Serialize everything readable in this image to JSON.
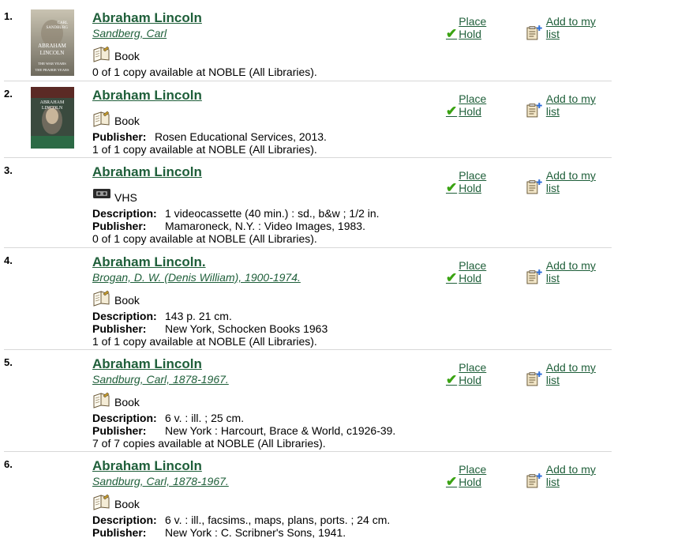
{
  "actions": {
    "place_hold": "Place Hold",
    "add_to_list": "Add to my list"
  },
  "labels": {
    "description": "Description:",
    "publisher": "Publisher:"
  },
  "covers": {
    "c1": {
      "line1": "CARL",
      "line2": "SANDBURG",
      "line3": "ABRAHAM",
      "line4": "LINCOLN",
      "line5": "THE WAR YEARS",
      "line6": "THE PRAIRIE YEARS"
    },
    "c2": {
      "title1": "ABRAHAM",
      "title2": "LINCOLN"
    }
  },
  "results": [
    {
      "num": "1.",
      "title": "Abraham Lincoln",
      "author": "Sandberg, Carl",
      "format": "Book",
      "availability": "0 of 1 copy available at NOBLE (All Libraries)."
    },
    {
      "num": "2.",
      "title": "Abraham Lincoln",
      "format": "Book",
      "publisher": "Rosen Educational Services, 2013.",
      "availability": "1 of 1 copy available at NOBLE (All Libraries)."
    },
    {
      "num": "3.",
      "title": "Abraham Lincoln",
      "format": "VHS",
      "description": "1 videocassette (40 min.) : sd., b&w ; 1/2 in.",
      "publisher": "Mamaroneck, N.Y. : Video Images, 1983.",
      "availability": "0 of 1 copy available at NOBLE (All Libraries)."
    },
    {
      "num": "4.",
      "title": "Abraham Lincoln.",
      "author": "Brogan, D. W. (Denis William), 1900-1974.",
      "format": "Book",
      "description": "143 p. 21 cm.",
      "publisher": "New York, Schocken Books 1963",
      "availability": "1 of 1 copy available at NOBLE (All Libraries)."
    },
    {
      "num": "5.",
      "title": "Abraham Lincoln",
      "author": "Sandburg, Carl, 1878-1967.",
      "format": "Book",
      "description": "6 v. : ill. ; 25 cm.",
      "publisher": "New York : Harcourt, Brace & World, c1926-39.",
      "availability": "7 of 7 copies available at NOBLE (All Libraries)."
    },
    {
      "num": "6.",
      "title": "Abraham Lincoln",
      "author": "Sandburg, Carl, 1878-1967.",
      "format": "Book",
      "description": "6 v. : ill., facsims., maps, plans, ports. ; 24 cm.",
      "publisher": "New York : C. Scribner's Sons, 1941."
    }
  ]
}
